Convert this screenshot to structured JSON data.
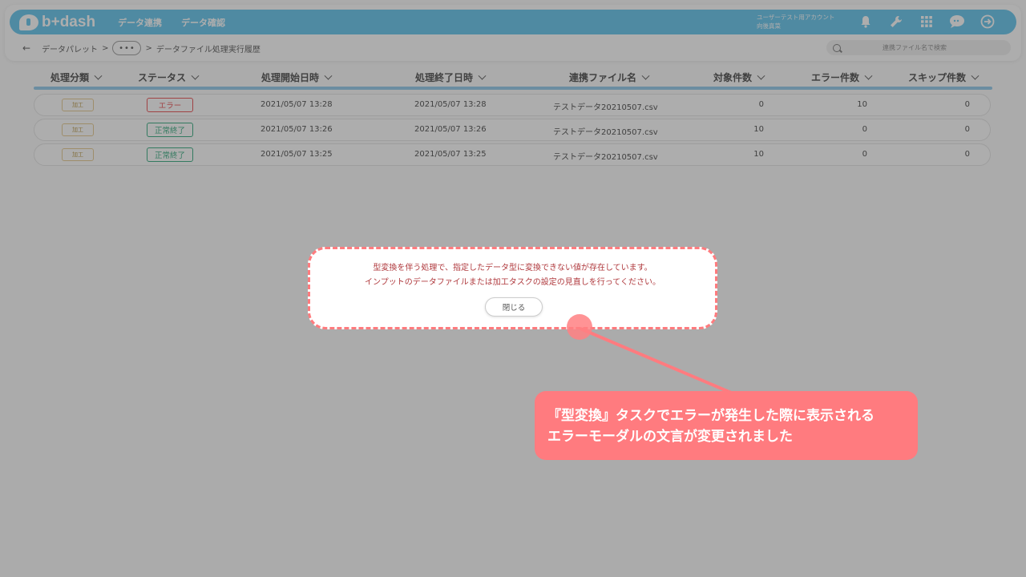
{
  "app": {
    "logo": "b+dash",
    "nav": [
      "データ連携",
      "データ確認"
    ],
    "user_line1": "ユーザーテスト用アカウント",
    "user_line2": "向後真菜",
    "icons": [
      "bell-icon",
      "wrench-icon",
      "apps-grid-icon",
      "chat-icon",
      "logout-icon"
    ]
  },
  "breadcrumb": {
    "back": "←",
    "items": [
      "データパレット",
      "•••",
      "データファイル処理実行履歴"
    ],
    "sep": ">"
  },
  "search": {
    "placeholder": "連携ファイル名で検索"
  },
  "table": {
    "headers": [
      "処理分類",
      "ステータス",
      "処理開始日時",
      "処理終了日時",
      "連携ファイル名",
      "対象件数",
      "エラー件数",
      "スキップ件数"
    ],
    "rows": [
      {
        "category": "加工",
        "status": "エラー",
        "status_type": "error",
        "start": "2021/05/07 13:28",
        "end": "2021/05/07 13:28",
        "file": "テストデータ20210507.csv",
        "target": "0",
        "errors": "10",
        "skip": "0"
      },
      {
        "category": "加工",
        "status": "正常終了",
        "status_type": "ok",
        "start": "2021/05/07 13:26",
        "end": "2021/05/07 13:26",
        "file": "テストデータ20210507.csv",
        "target": "10",
        "errors": "0",
        "skip": "0"
      },
      {
        "category": "加工",
        "status": "正常終了",
        "status_type": "ok",
        "start": "2021/05/07 13:25",
        "end": "2021/05/07 13:25",
        "file": "テストデータ20210507.csv",
        "target": "10",
        "errors": "0",
        "skip": "0"
      }
    ]
  },
  "modal": {
    "line1": "型変換を伴う処理で、指定したデータ型に変換できない値が存在しています。",
    "line2": "インプットのデータファイルまたは加工タスクの設定の見直しを行ってください。",
    "close_label": "閉じる"
  },
  "callout": {
    "line1": "『型変換』タスクでエラーが発生した際に表示される",
    "line2": "エラーモーダルの文言が変更されました"
  },
  "colors": {
    "brand": "#5ec3ec",
    "error": "#e8474b",
    "ok": "#2ea87a",
    "annotation": "#ff7b7f"
  }
}
